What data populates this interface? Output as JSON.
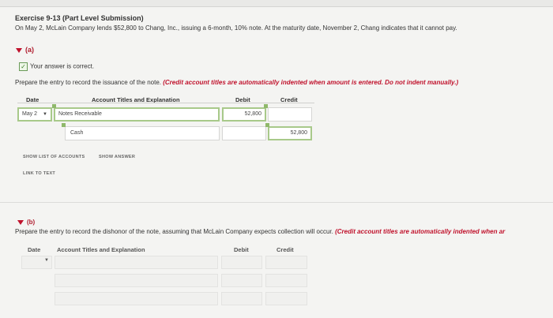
{
  "exercise": {
    "title": "Exercise 9-13 (Part Level Submission)",
    "problem": "On May 2, McLain Company lends $52,800 to Chang, Inc., issuing a 6-month, 10% note. At the maturity date, November 2, Chang indicates that it cannot pay."
  },
  "part_a": {
    "label": "(a)",
    "status": "Your answer is correct.",
    "instruction_plain": "Prepare the entry to record the issuance of the note. ",
    "instruction_red": "(Credit account titles are automatically indented when amount is entered. Do not indent manually.)",
    "headers": {
      "date": "Date",
      "account": "Account Titles and Explanation",
      "debit": "Debit",
      "credit": "Credit"
    },
    "rows": [
      {
        "date": "May 2",
        "account": "Notes Receivable",
        "debit": "52,800",
        "credit": ""
      },
      {
        "date": "",
        "account": "Cash",
        "debit": "",
        "credit": "52,800"
      }
    ],
    "buttons": {
      "show_list": "SHOW LIST OF ACCOUNTS",
      "show_answer": "SHOW ANSWER",
      "link_text": "LINK TO TEXT"
    }
  },
  "part_b": {
    "label": "(b)",
    "instruction_plain": "Prepare the entry to record the dishonor of the note, assuming that McLain Company expects collection will occur. ",
    "instruction_red": "(Credit account titles are automatically indented when ar",
    "headers": {
      "date": "Date",
      "account": "Account Titles and Explanation",
      "debit": "Debit",
      "credit": "Credit"
    },
    "rows": [
      {
        "date": "",
        "account": "",
        "debit": "",
        "credit": ""
      },
      {
        "date": "",
        "account": "",
        "debit": "",
        "credit": ""
      },
      {
        "date": "",
        "account": "",
        "debit": "",
        "credit": ""
      }
    ]
  },
  "icons": {
    "caret": "caret-down-icon",
    "check": "checkbox-checked-icon",
    "dropdown": "dropdown-arrow-icon"
  },
  "colors": {
    "accent_red": "#c0122c",
    "correct_green": "#8fb86b"
  }
}
